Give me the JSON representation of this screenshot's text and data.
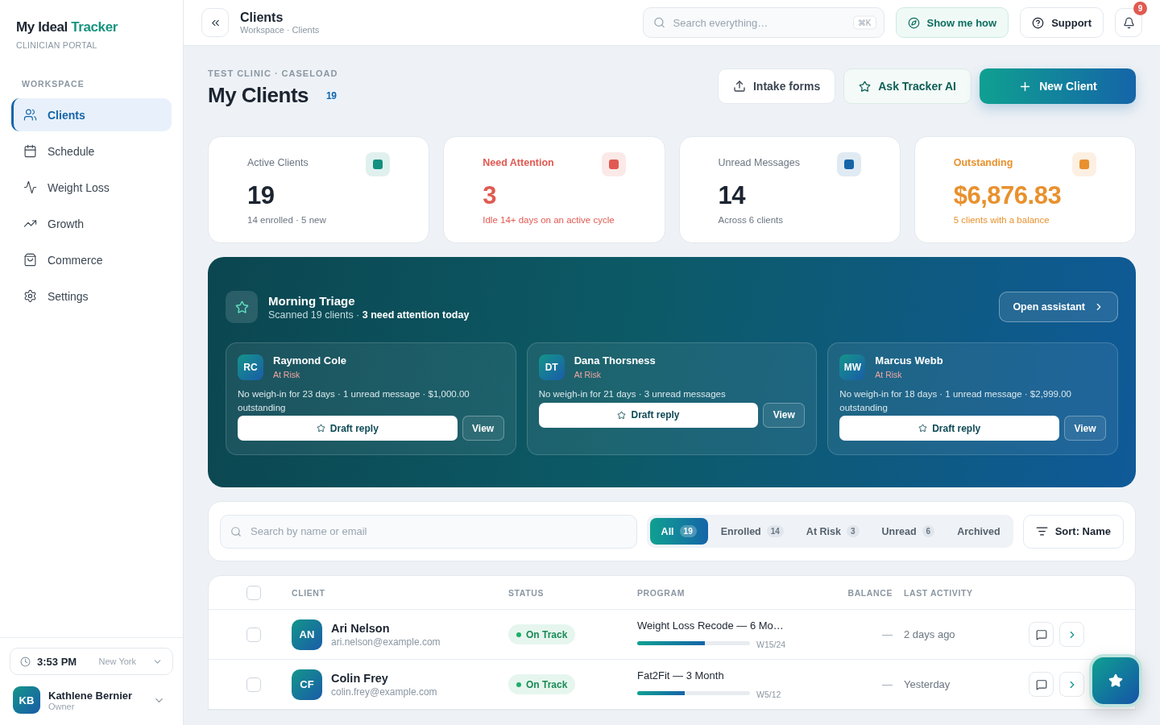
{
  "brand": {
    "name": "My Ideal",
    "accent": "Tracker",
    "subtitle": "CLINICIAN PORTAL"
  },
  "sidebar": {
    "section": "WORKSPACE",
    "items": [
      {
        "label": "Clients",
        "selected": true
      },
      {
        "label": "Schedule",
        "selected": false
      },
      {
        "label": "Weight Loss",
        "selected": false
      },
      {
        "label": "Growth",
        "selected": false
      },
      {
        "label": "Commerce",
        "selected": false
      },
      {
        "label": "Settings",
        "selected": false
      }
    ]
  },
  "clock": {
    "time": "3:53 PM",
    "city": "New York"
  },
  "user": {
    "initials": "KB",
    "name": "Kathlene Bernier",
    "role": "Owner"
  },
  "topbar": {
    "title": "Clients",
    "breadcrumb": "Workspace · Clients",
    "search_placeholder": "Search everything…",
    "shortcut": "⌘K",
    "guide_button": "Show me how",
    "support_button": "Support",
    "notifications": "9"
  },
  "header": {
    "eyebrow": "TEST CLINIC · CASELOAD",
    "title": "My Clients",
    "count": "19",
    "actions": [
      {
        "label": "Intake forms",
        "kind": "outline"
      },
      {
        "label": "Ask Tracker AI",
        "kind": "soft"
      },
      {
        "label": "New Client",
        "kind": "primary"
      }
    ]
  },
  "stats": [
    {
      "label": "Active Clients",
      "value": "19",
      "note": "14 enrolled · 5 new",
      "color": "#13907f",
      "accent": false
    },
    {
      "label": "Need Attention",
      "value": "3",
      "note": "Idle 14+ days on an active cycle",
      "color": "#e05a52",
      "accent": true
    },
    {
      "label": "Unread Messages",
      "value": "14",
      "note": "Across 6 clients",
      "color": "#1565a8",
      "accent": false
    },
    {
      "label": "Outstanding",
      "value": "$6,876.83",
      "note": "5 clients with a balance",
      "color": "#e8912e",
      "accent": true
    }
  ],
  "triage": {
    "title": "Morning Triage",
    "summary": "Scanned 19 clients · **3 need attention today**",
    "button": "Open assistant",
    "cards": [
      {
        "initials": "RC",
        "name": "Raymond Cole",
        "status": "At Risk",
        "detail": "No weigh-in for 23 days · 1 unread message · $1,000.00 outstanding",
        "draft": "Draft reply",
        "view": "View"
      },
      {
        "initials": "DT",
        "name": "Dana Thorsness",
        "status": "At Risk",
        "detail": "No weigh-in for 21 days · 3 unread messages",
        "draft": "Draft reply",
        "view": "View"
      },
      {
        "initials": "MW",
        "name": "Marcus Webb",
        "status": "At Risk",
        "detail": "No weigh-in for 18 days · 1 unread message · $2,999.00 outstanding",
        "draft": "Draft reply",
        "view": "View"
      }
    ]
  },
  "filters": {
    "search_placeholder": "Search by name or email",
    "sort": "Sort: Name",
    "tabs": [
      {
        "label": "All",
        "count": "19",
        "selected": true
      },
      {
        "label": "Enrolled",
        "count": "14",
        "selected": false
      },
      {
        "label": "At Risk",
        "count": "3",
        "selected": false
      },
      {
        "label": "Unread",
        "count": "6",
        "selected": false
      },
      {
        "label": "Archived",
        "selected": false
      }
    ]
  },
  "table": {
    "all_checked": false,
    "columns": [
      "CLIENT",
      "STATUS",
      "PROGRAM",
      "BALANCE",
      "LAST ACTIVITY"
    ],
    "rows": [
      {
        "checked": false,
        "initials": "AN",
        "name": "Ari Nelson",
        "email": "ari.nelson@example.com",
        "status": "On Track",
        "program": "Weight Loss Recode — 6 Mo…",
        "level": 0.6,
        "week": "W15/24",
        "balance": "—",
        "activity": "2 days ago"
      },
      {
        "checked": false,
        "initials": "CF",
        "name": "Colin Frey",
        "email": "colin.frey@example.com",
        "status": "On Track",
        "program": "Fat2Fit — 3 Month",
        "level": 0.42,
        "week": "W5/12",
        "balance": "—",
        "activity": "Yesterday"
      }
    ]
  }
}
